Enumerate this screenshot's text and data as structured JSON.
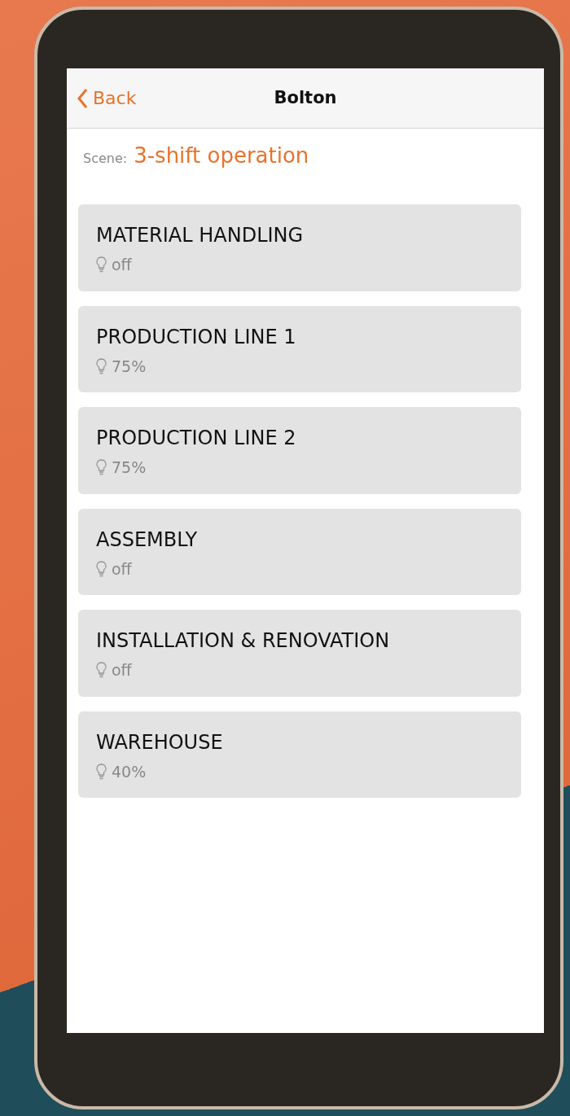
{
  "nav_bar": {
    "back_label": "Back",
    "title": "Bolton"
  },
  "scene": {
    "label": "Scene:",
    "value": "3-shift operation"
  },
  "zones": [
    {
      "name": "MATERIAL HANDLING",
      "status": "off"
    },
    {
      "name": "PRODUCTION LINE 1",
      "status": "75%"
    },
    {
      "name": "PRODUCTION LINE 2",
      "status": "75%"
    },
    {
      "name": "ASSEMBLY",
      "status": "off"
    },
    {
      "name": "INSTALLATION & RENOVATION",
      "status": "off"
    },
    {
      "name": "WAREHOUSE",
      "status": "40%"
    }
  ]
}
